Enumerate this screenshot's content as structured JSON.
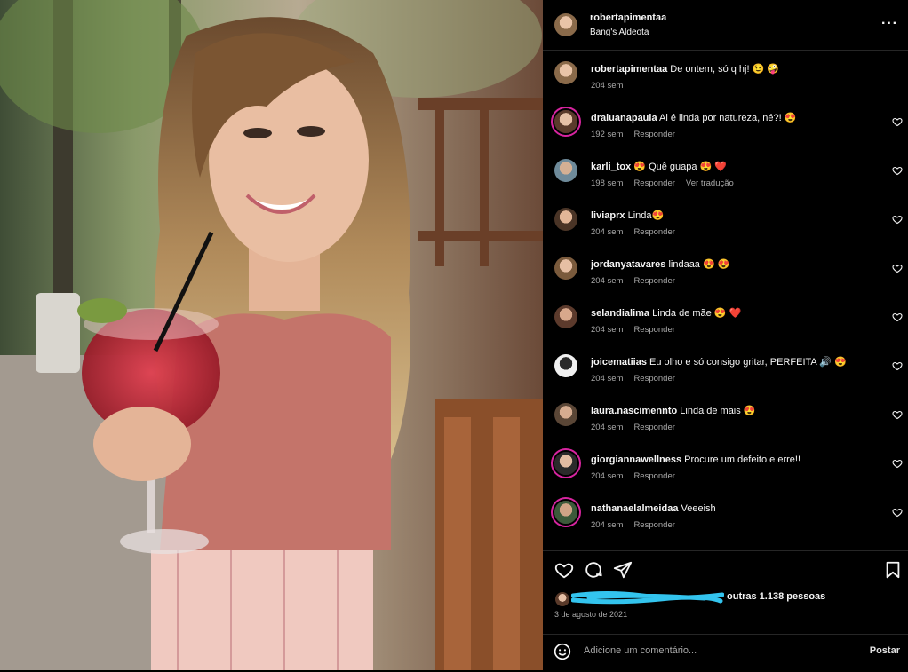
{
  "post": {
    "author": "robertapimentaa",
    "location": "Bang's Aldeota",
    "caption": "De ontem, só q hj! 😉 🤪",
    "caption_time": "204 sem",
    "date": "3 de agosto de 2021",
    "likes_suffix": "outras 1.138 pessoas",
    "add_comment_placeholder": "Adicione um comentário...",
    "post_label": "Postar",
    "more_label": "···"
  },
  "reply_label": "Responder",
  "translate_label": "Ver tradução",
  "comments": [
    {
      "user": "draluanapaula",
      "text": "Ai é linda por natureza, né?! 😍",
      "time": "192 sem",
      "translate": false
    },
    {
      "user": "karli_tox",
      "text": "😍 Quê guapa 😍 ❤️",
      "time": "198 sem",
      "translate": true
    },
    {
      "user": "liviaprx",
      "text": "Linda😍",
      "time": "204 sem",
      "translate": false
    },
    {
      "user": "jordanyatavares",
      "text": "lindaaa 😍 😍",
      "time": "204 sem",
      "translate": false
    },
    {
      "user": "selandialima",
      "text": "Linda de mãe 😍 ❤️",
      "time": "204 sem",
      "translate": false
    },
    {
      "user": "joicematiias",
      "text": "Eu olho e só consigo gritar, PERFEITA 🔊 😍",
      "time": "204 sem",
      "translate": false
    },
    {
      "user": "laura.nascimennto",
      "text": "Linda de mais 😍",
      "time": "204 sem",
      "translate": false
    },
    {
      "user": "giorgiannawellness",
      "text": "Procure um defeito e erre!!",
      "time": "204 sem",
      "translate": false
    },
    {
      "user": "nathanaelalmeidaa",
      "text": "Veeeish",
      "time": "204 sem",
      "translate": false
    }
  ],
  "icons": [
    "heart-icon",
    "comment-icon",
    "share-icon",
    "save-icon",
    "emoji-icon",
    "more-icon"
  ],
  "colors": {
    "background": "#000000",
    "text": "#f5f5f5",
    "muted": "#a8a8a8",
    "scribble": "#33c4ee",
    "story_ring": "#d6249f"
  }
}
